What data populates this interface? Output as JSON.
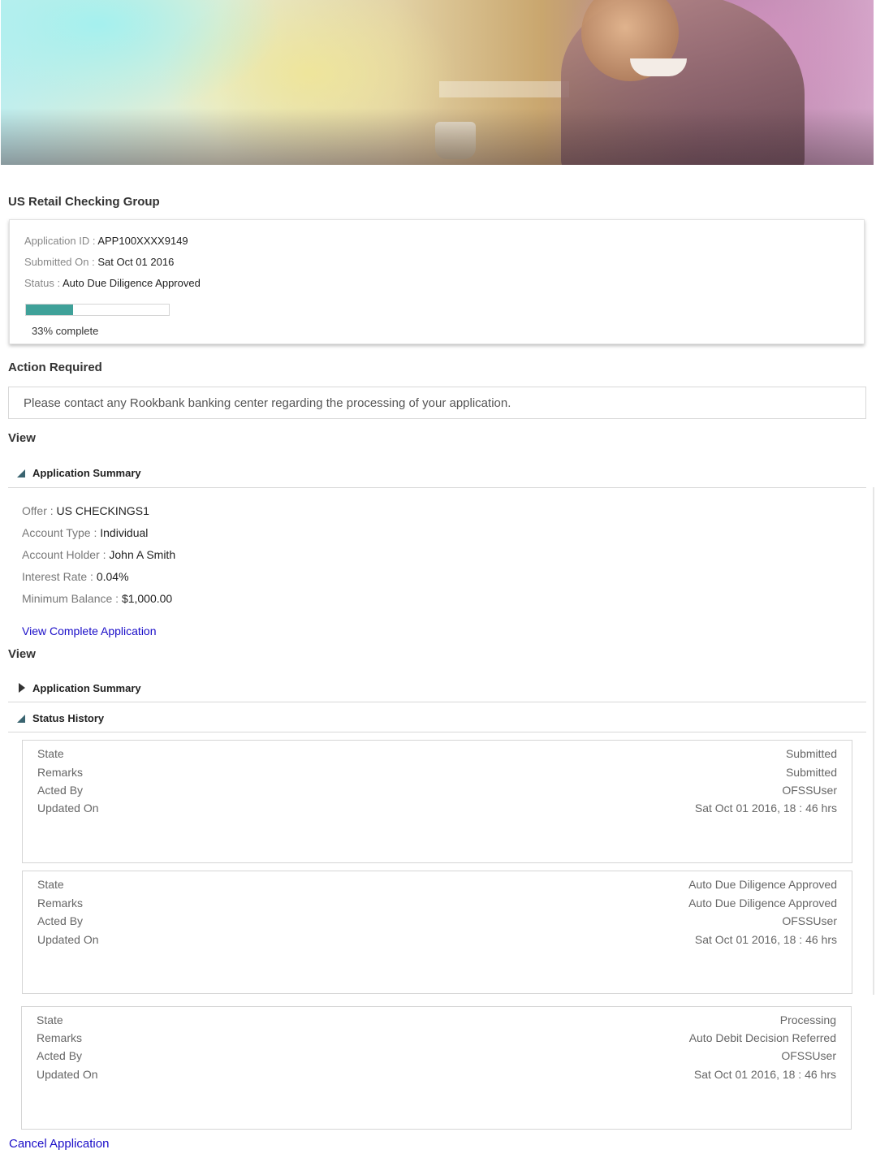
{
  "header": {
    "group_title": "US Retail Checking Group"
  },
  "application": {
    "id_label": "Application ID :",
    "id_value": "APP100XXXX9149",
    "submitted_label": "Submitted On :",
    "submitted_value": "Sat Oct 01 2016",
    "status_label": "Status :",
    "status_value": "Auto Due Diligence Approved",
    "progress_percent": 33,
    "progress_text": "33% complete"
  },
  "action_required": {
    "heading": "Action Required",
    "message": "Please contact any Rookbank banking center regarding the processing of your application."
  },
  "view1": {
    "heading": "View",
    "summary_label": "Application Summary",
    "summary": [
      {
        "label": "Offer :",
        "value": "US CHECKINGS1"
      },
      {
        "label": "Account Type :",
        "value": "Individual"
      },
      {
        "label": "Account Holder :",
        "value": "John A Smith"
      },
      {
        "label": "Interest Rate :",
        "value": "0.04%"
      },
      {
        "label": "Minimum Balance :",
        "value": "$1,000.00"
      }
    ],
    "view_complete_link": "View Complete Application"
  },
  "view2": {
    "heading": "View",
    "summary_label": "Application Summary",
    "history_label": "Status History",
    "history_fields": [
      "State",
      "Remarks",
      "Acted By",
      "Updated On"
    ],
    "history": [
      {
        "state": "Submitted",
        "remarks": "Submitted",
        "acted_by": "OFSSUser",
        "updated_on": "Sat Oct 01 2016, 18 : 46 hrs"
      },
      {
        "state": "Auto Due Diligence Approved",
        "remarks": "Auto Due Diligence Approved",
        "acted_by": "OFSSUser",
        "updated_on": "Sat Oct 01 2016, 18 : 46 hrs"
      },
      {
        "state": "Processing",
        "remarks": "Auto Debit Decision Referred",
        "acted_by": "OFSSUser",
        "updated_on": "Sat Oct 01 2016, 18 : 46 hrs"
      }
    ]
  },
  "footer": {
    "cancel_link": "Cancel Application"
  },
  "colors": {
    "progress_fill": "#3fa199",
    "link": "#1a0dc8",
    "accordion_icon": "#3a6470"
  }
}
